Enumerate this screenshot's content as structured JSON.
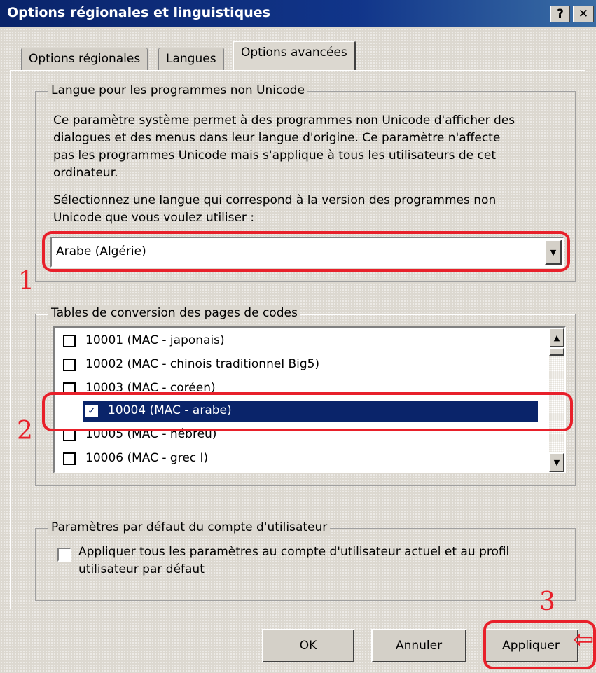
{
  "window": {
    "title": "Options régionales et linguistiques",
    "help_label": "?",
    "close_label": "✕"
  },
  "tabs": [
    {
      "label": "Options régionales"
    },
    {
      "label": "Langues"
    },
    {
      "label": "Options avancées"
    }
  ],
  "non_unicode": {
    "legend": "Langue pour les programmes non Unicode",
    "description_lines": [
      "Ce paramètre système permet à des programmes non Unicode d'afficher des",
      "dialogues et des menus dans leur langue d'origine. Ce paramètre n'affecte",
      "pas les programmes Unicode mais s'applique à tous les utilisateurs de cet",
      "ordinateur."
    ],
    "prompt_lines": [
      "Sélectionnez une langue qui correspond à la version des programmes non",
      "Unicode que vous voulez utiliser :"
    ],
    "selected_language": "Arabe (Algérie)"
  },
  "code_pages": {
    "legend": "Tables de conversion des pages de codes",
    "items": [
      {
        "label": "10001 (MAC - japonais)",
        "checked": false
      },
      {
        "label": "10002 (MAC - chinois traditionnel Big5)",
        "checked": false
      },
      {
        "label": "10003 (MAC - coréen)",
        "checked": false
      },
      {
        "label": "10004 (MAC - arabe)",
        "checked": true
      },
      {
        "label": "10005 (MAC - hébreu)",
        "checked": false
      },
      {
        "label": "10006 (MAC - grec I)",
        "checked": false
      }
    ]
  },
  "user_defaults": {
    "legend": "Paramètres par défaut du compte d'utilisateur",
    "checkbox_lines": [
      "Appliquer tous les paramètres au compte d'utilisateur actuel et au profil",
      "utilisateur par défaut"
    ],
    "checked": false
  },
  "buttons": {
    "ok": "OK",
    "cancel": "Annuler",
    "apply": "Appliquer"
  },
  "annotations": {
    "marker_1": "1",
    "marker_2": "2",
    "marker_3": "3",
    "arrow": "⇦",
    "color": "#e8202a"
  },
  "colors": {
    "titlebar": "#0a246a",
    "selection": "#0a246a"
  }
}
